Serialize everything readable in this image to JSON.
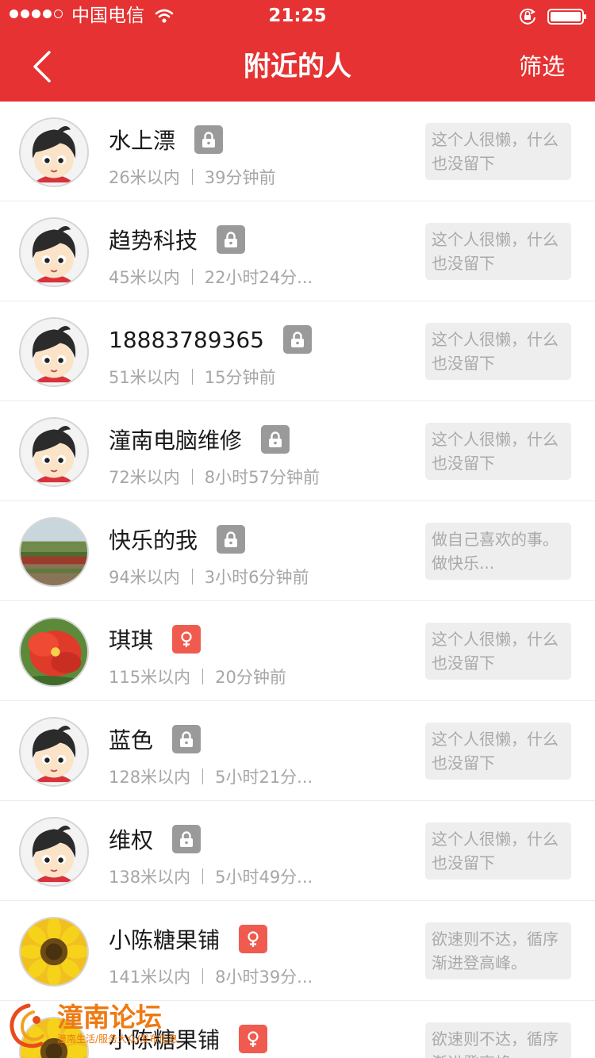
{
  "status_bar": {
    "carrier": "中国电信",
    "time": "21:25"
  },
  "nav": {
    "title": "附近的人",
    "filter_label": "筛选"
  },
  "colors": {
    "header_red": "#e63232",
    "lock_badge_gray": "#9a9a9a",
    "female_badge_red": "#f05b50",
    "bio_background": "#eeeeee",
    "meta_gray": "#a6a6a6"
  },
  "users": [
    {
      "name": "水上漂",
      "avatar": "cartoon-girl",
      "badge": "lock-icon",
      "distance": "26米以内",
      "last_seen": "39分钟前",
      "bio": "这个人很懒，什么也没留下"
    },
    {
      "name": "趋势科技",
      "avatar": "cartoon-girl",
      "badge": "lock-icon",
      "distance": "45米以内",
      "last_seen": "22小时24分...",
      "bio": "这个人很懒，什么也没留下"
    },
    {
      "name": "18883789365",
      "avatar": "cartoon-girl",
      "badge": "lock-icon",
      "distance": "51米以内",
      "last_seen": "15分钟前",
      "bio": "这个人很懒，什么也没留下"
    },
    {
      "name": "潼南电脑维修",
      "avatar": "cartoon-girl",
      "badge": "lock-icon",
      "distance": "72米以内",
      "last_seen": "8小时57分钟前",
      "bio": "这个人很懒，什么也没留下"
    },
    {
      "name": "快乐的我",
      "avatar": "landscape-photo",
      "badge": "lock-icon",
      "distance": "94米以内",
      "last_seen": "3小时6分钟前",
      "bio": "做自己喜欢的事。做快乐..."
    },
    {
      "name": "琪琪",
      "avatar": "red-flower-photo",
      "badge": "female-icon",
      "distance": "115米以内",
      "last_seen": "20分钟前",
      "bio": "这个人很懒，什么也没留下"
    },
    {
      "name": "蓝色",
      "avatar": "cartoon-girl",
      "badge": "lock-icon",
      "distance": "128米以内",
      "last_seen": "5小时21分...",
      "bio": "这个人很懒，什么也没留下"
    },
    {
      "name": "维权",
      "avatar": "cartoon-girl",
      "badge": "lock-icon",
      "distance": "138米以内",
      "last_seen": "5小时49分...",
      "bio": "这个人很懒，什么也没留下"
    },
    {
      "name": "小陈糖果铺",
      "avatar": "sunflower-photo",
      "badge": "female-icon",
      "distance": "141米以内",
      "last_seen": "8小时39分...",
      "bio": "欲速则不达，循序渐进登高峰。"
    },
    {
      "name": "小陈糖果铺",
      "avatar": "sunflower-photo",
      "badge": "female-icon",
      "distance": "",
      "last_seen": "",
      "bio": "欲速则不达，循序渐进登高峰。"
    }
  ],
  "watermark": {
    "title": "潼南论坛",
    "subtitle": "潼南生活/服务大众/发布信息"
  }
}
